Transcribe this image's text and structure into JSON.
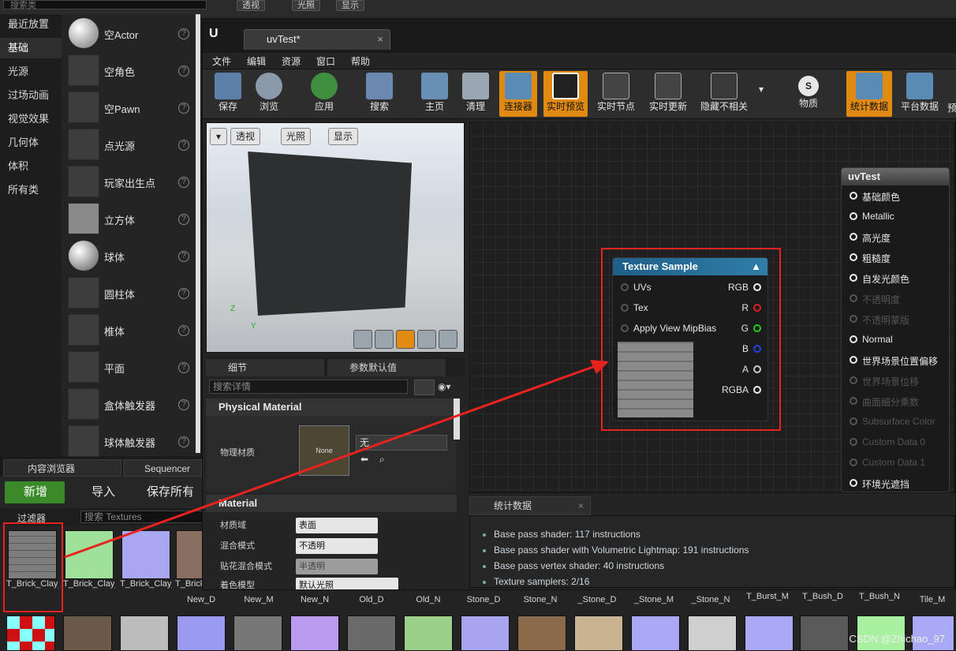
{
  "top": {
    "search_placeholder": "搜索类",
    "btn_persp": "透视",
    "btn_lit": "光照",
    "btn_show": "显示"
  },
  "place": {
    "categories": [
      "最近放置",
      "基础",
      "光源",
      "过场动画",
      "视觉效果",
      "几何体",
      "体积",
      "所有类"
    ],
    "items": [
      "空Actor",
      "空角色",
      "空Pawn",
      "点光源",
      "玩家出生点",
      "立方体",
      "球体",
      "圆柱体",
      "椎体",
      "平面",
      "盒体触发器",
      "球体触发器"
    ],
    "help": "?"
  },
  "content_browser": {
    "tab1": "内容浏览器",
    "tab2": "Sequencer",
    "new": "新增",
    "import": "导入",
    "save_all": "保存所有",
    "filter": "过滤器",
    "search_placeholder": "搜索 Textures",
    "assets_row1": [
      "T_Brick_Clay_Beveled_D",
      "T_Brick_Clay_Beveled_M",
      "T_Brick_Clay_Beveled_N",
      "T_Brick_"
    ],
    "assets_row2": [
      "New_D",
      "New_M",
      "New_N",
      "Old_D",
      "Old_N",
      "Stone_D",
      "Stone_N",
      "_Stone_D",
      "_Stone_M",
      "_Stone_N",
      "T_Burst_M",
      "T_Bush_D",
      "T_Bush_N",
      "Tile_M"
    ]
  },
  "editor": {
    "tab_title": "uvTest*",
    "menus": [
      "文件",
      "编辑",
      "资源",
      "窗口",
      "帮助"
    ],
    "toolbar": [
      "保存",
      "浏览",
      "应用",
      "搜索",
      "主页",
      "清理",
      "连接器",
      "实时预览",
      "实时节点",
      "实时更新",
      "隐藏不相关",
      "物质",
      "统计数据",
      "平台数据",
      "预"
    ],
    "viewport": {
      "persp": "透视",
      "lit": "光照",
      "show": "显示",
      "axis_x": "Y",
      "axis_z": "Z"
    },
    "details": {
      "tab1": "细节",
      "tab2": "参数默认值",
      "search_placeholder": "搜索详情",
      "section1": "Physical Material",
      "phys_label": "物理材质",
      "phys_none": "None",
      "phys_value": "无",
      "section2": "Material",
      "rows": [
        {
          "label": "材质域",
          "value": "表面"
        },
        {
          "label": "混合模式",
          "value": "不透明"
        },
        {
          "label": "贴花混合模式",
          "value": "半透明"
        },
        {
          "label": "着色模型",
          "value": "默认光照"
        }
      ]
    },
    "output_node": {
      "title": "uvTest",
      "pins": [
        {
          "name": "基础颜色",
          "enabled": true
        },
        {
          "name": "Metallic",
          "enabled": true
        },
        {
          "name": "高光度",
          "enabled": true
        },
        {
          "name": "粗糙度",
          "enabled": true
        },
        {
          "name": "自发光颜色",
          "enabled": true
        },
        {
          "name": "不透明度",
          "enabled": false
        },
        {
          "name": "不透明蒙版",
          "enabled": false
        },
        {
          "name": "Normal",
          "enabled": true
        },
        {
          "name": "世界场景位置偏移",
          "enabled": true
        },
        {
          "name": "世界场景位移",
          "enabled": false
        },
        {
          "name": "曲面细分乘数",
          "enabled": false
        },
        {
          "name": "Subsurface Color",
          "enabled": false
        },
        {
          "name": "Custom Data 0",
          "enabled": false
        },
        {
          "name": "Custom Data 1",
          "enabled": false
        },
        {
          "name": "环境光遮挡",
          "enabled": true
        }
      ]
    },
    "texture_node": {
      "title": "Texture Sample",
      "inputs": [
        "UVs",
        "Tex",
        "Apply View MipBias"
      ],
      "outputs": [
        {
          "name": "RGB",
          "color": "#eeeeee"
        },
        {
          "name": "R",
          "color": "#e02020"
        },
        {
          "name": "G",
          "color": "#20d020"
        },
        {
          "name": "B",
          "color": "#2040e0"
        },
        {
          "name": "A",
          "color": "#cccccc"
        },
        {
          "name": "RGBA",
          "color": "#eeeeee"
        }
      ]
    },
    "stats": {
      "tab": "统计数据",
      "lines": [
        "Base pass shader: 117 instructions",
        "Base pass shader with Volumetric Lightmap: 191 instructions",
        "Base pass vertex shader: 40 instructions",
        "Texture samplers: 2/16"
      ]
    }
  },
  "watermark": "CSDN @Zhichao_97",
  "colors": {
    "accent": "#e08a12",
    "highlight_red": "#e8231f",
    "node_header": "#2f7ea8",
    "new_button": "#3a8a2a"
  }
}
